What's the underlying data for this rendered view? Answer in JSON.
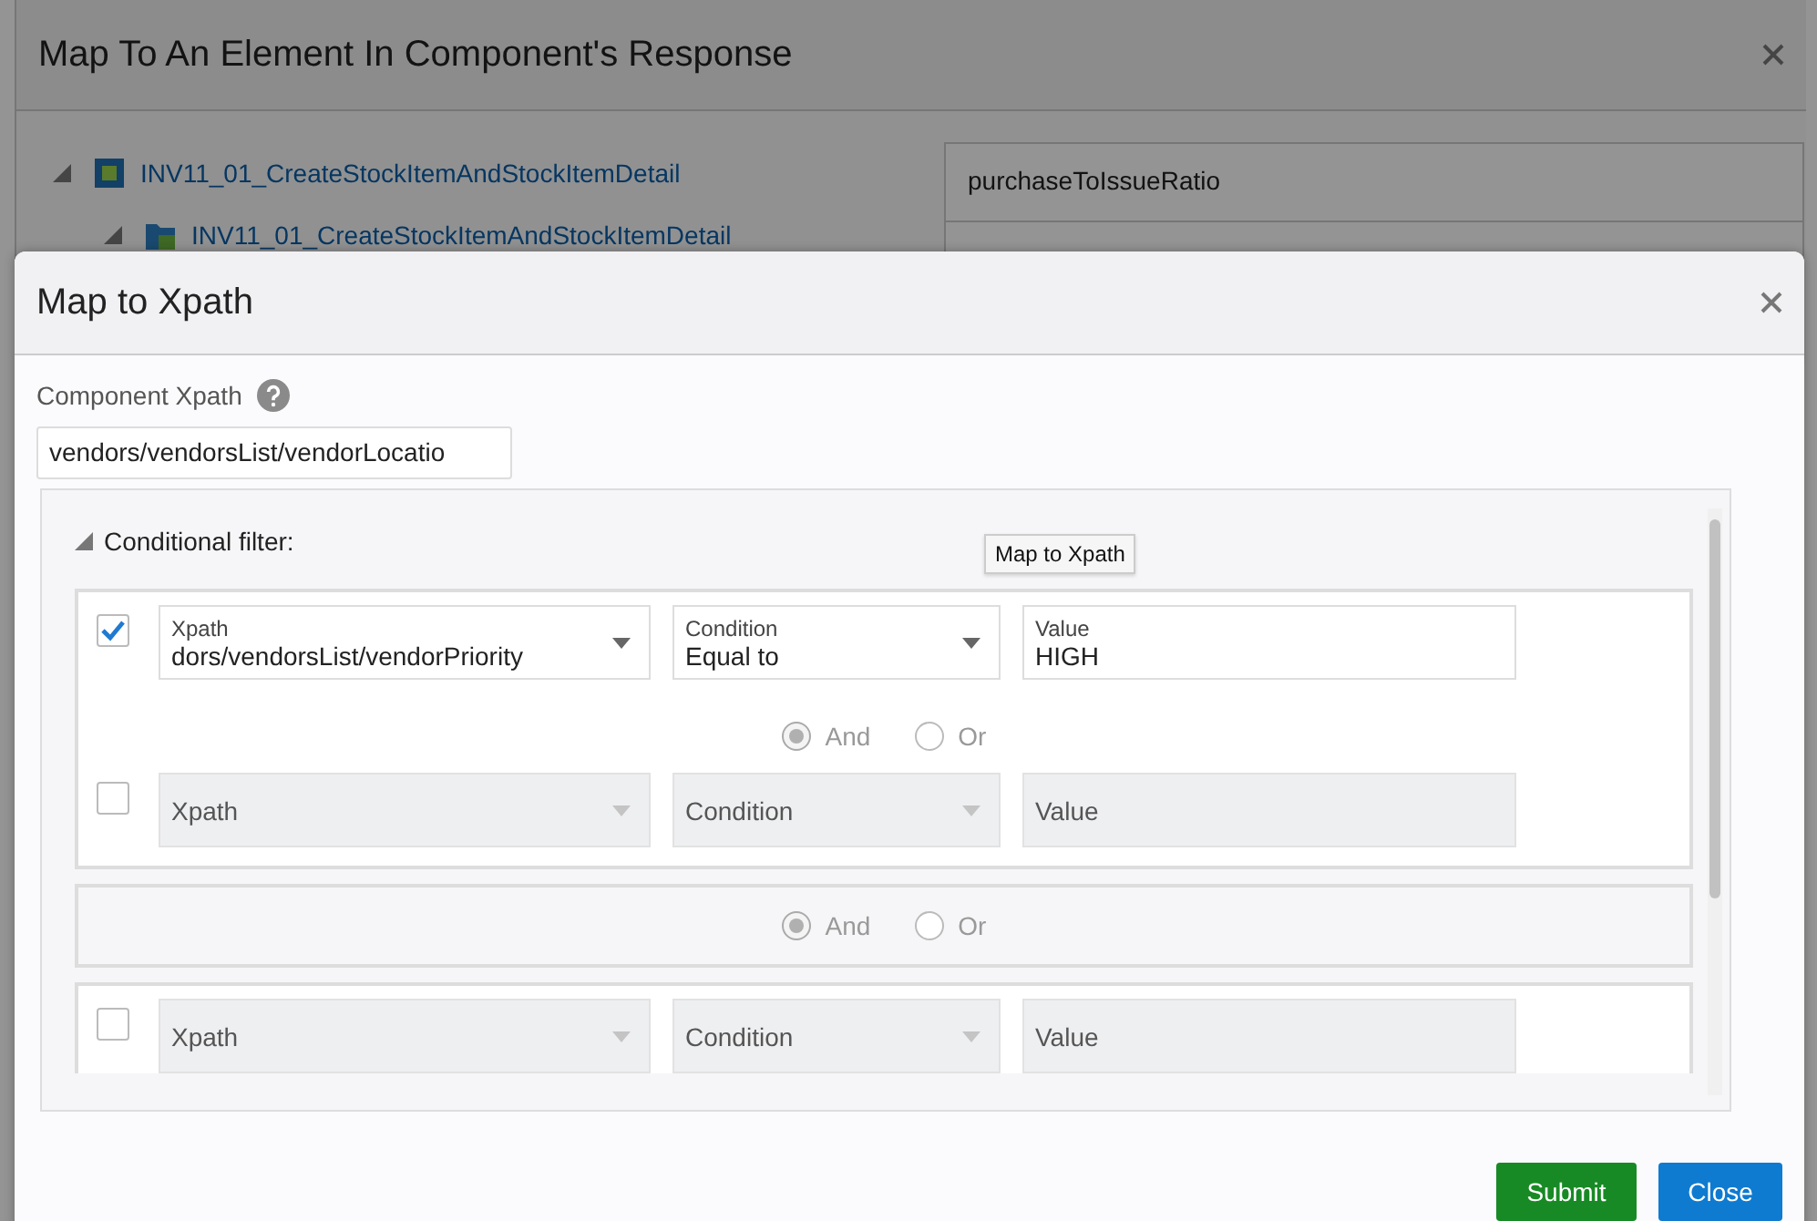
{
  "back_dialog": {
    "title": "Map To An Element In Component's Response",
    "tree": [
      {
        "label": "INV11_01_CreateStockItemAndStockItemDetail",
        "expanded": true,
        "children": [
          {
            "label": "INV11_01_CreateStockItemAndStockItemDetail",
            "expanded": true
          }
        ]
      }
    ],
    "fields": [
      "purchaseToIssueRatio"
    ]
  },
  "dialog": {
    "title": "Map to Xpath",
    "xpath_label": "Component Xpath",
    "xpath_value": "vendors/vendorsList/vendorLocatio",
    "tooltip": "Map to Xpath",
    "filter": {
      "label": "Conditional filter:",
      "expanded": true,
      "boxes": [
        {
          "rows": [
            {
              "kind": "condition",
              "checked": true,
              "disabled": false,
              "xpath": {
                "label": "Xpath",
                "value": "dors/vendorsList/vendorPriority"
              },
              "condition": {
                "label": "Condition",
                "value": "Equal to"
              },
              "value": {
                "label": "Value",
                "value": "HIGH"
              }
            },
            {
              "kind": "operator",
              "options": [
                {
                  "label": "And",
                  "selected": true
                },
                {
                  "label": "Or",
                  "selected": false
                }
              ]
            },
            {
              "kind": "condition",
              "checked": false,
              "disabled": true,
              "xpath": {
                "placeholder": "Xpath"
              },
              "condition": {
                "placeholder": "Condition"
              },
              "value": {
                "placeholder": "Value"
              }
            }
          ]
        },
        {
          "rows": [
            {
              "kind": "operator",
              "options": [
                {
                  "label": "And",
                  "selected": true
                },
                {
                  "label": "Or",
                  "selected": false
                }
              ]
            }
          ]
        },
        {
          "rows": [
            {
              "kind": "condition",
              "checked": false,
              "disabled": true,
              "xpath": {
                "placeholder": "Xpath"
              },
              "condition": {
                "placeholder": "Condition"
              },
              "value": {
                "placeholder": "Value"
              }
            }
          ]
        }
      ]
    },
    "buttons": [
      {
        "label": "Submit",
        "kind": "primary"
      },
      {
        "label": "Close",
        "kind": "secondary"
      }
    ]
  }
}
